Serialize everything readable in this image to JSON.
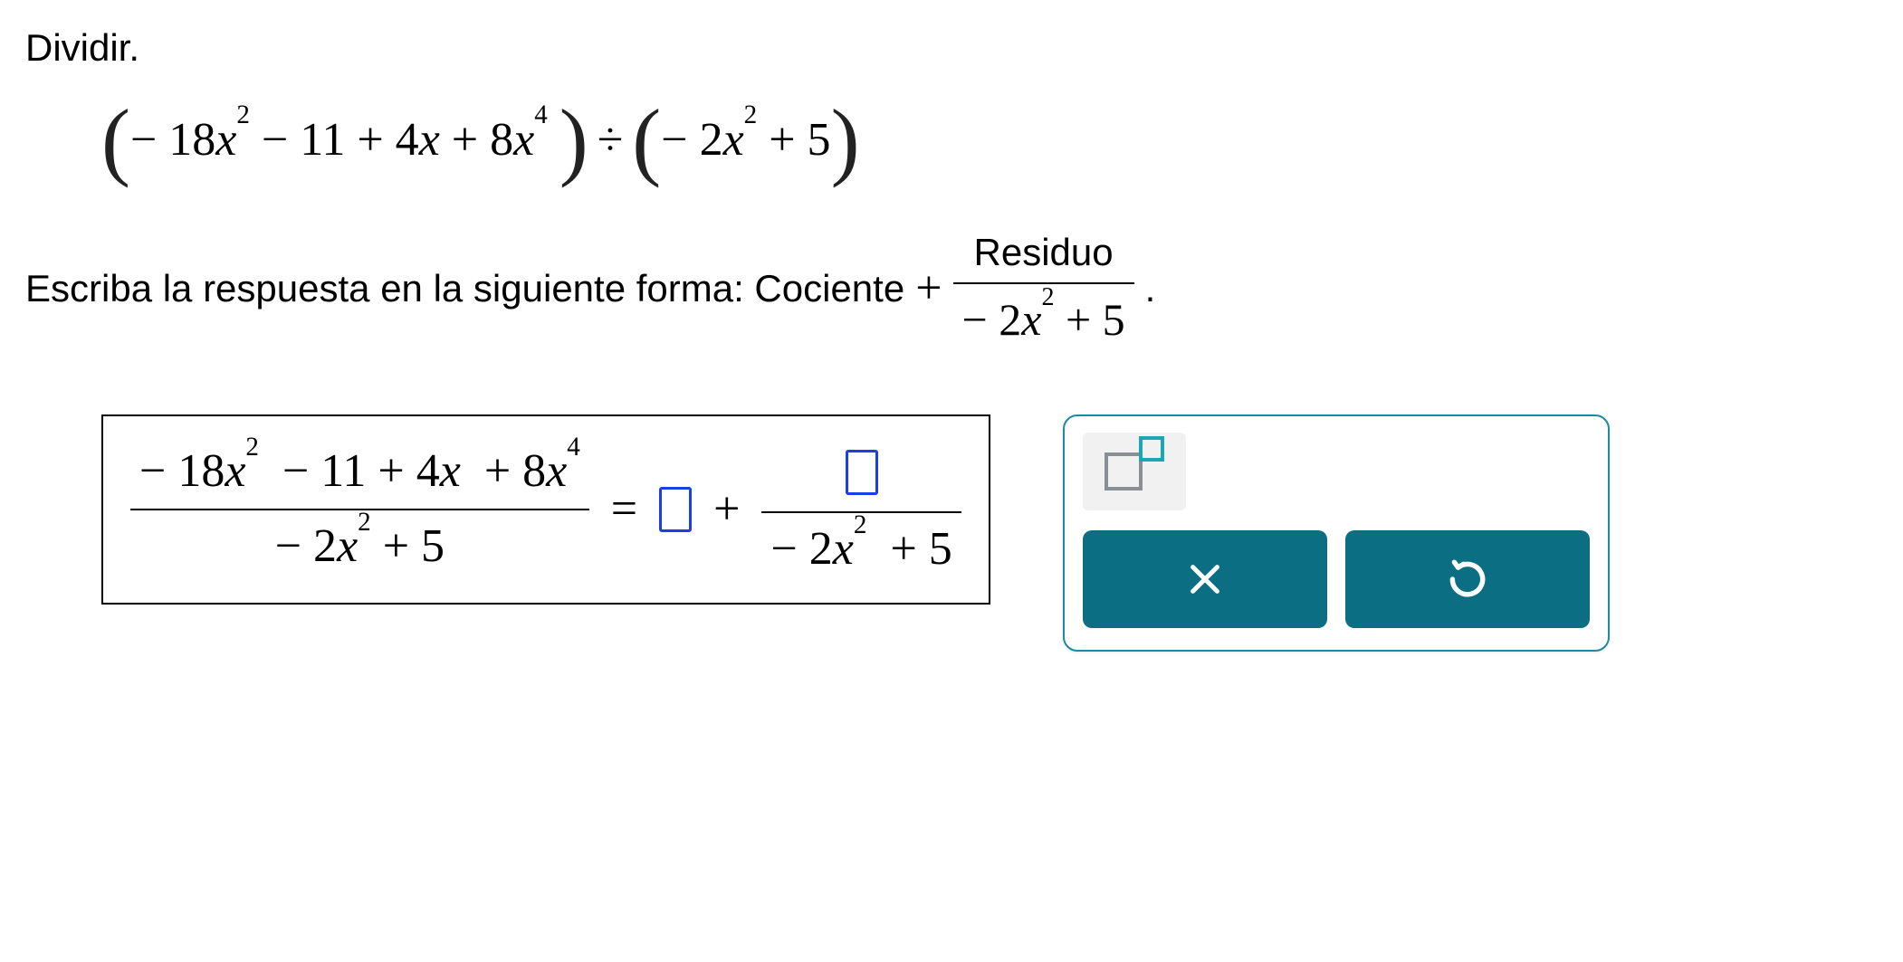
{
  "prompt": "Dividir.",
  "expression": {
    "dividend": "− 18x² − 11 + 4x + 8x⁴",
    "divisor": "− 2x² + 5",
    "dividend_terms": {
      "a": "− 18",
      "b": "− 11 + 4",
      "c": "+ 8"
    },
    "divisor_terms": {
      "a": "− 2",
      "b": "+ 5"
    },
    "op": "÷"
  },
  "form": {
    "text1": "Escriba la respuesta en la siguiente forma: Cociente",
    "plus": "+",
    "frac_top": "Residuo",
    "frac_bot_a": "− 2",
    "frac_bot_b": "+ 5",
    "period": "."
  },
  "answer": {
    "lhs_num_a": "− 18",
    "lhs_num_b": "− 11 + 4",
    "lhs_num_c": "+ 8",
    "lhs_den_a": "− 2",
    "lhs_den_b": "+ 5",
    "eq": "=",
    "quotient_value": "",
    "plus": "+",
    "remainder_value": "",
    "rden_a": "− 2",
    "rden_b": " + 5"
  },
  "panel": {
    "tool_name": "exponent",
    "clear": "clear",
    "undo": "undo"
  },
  "icons": {
    "exponent": "exponent-icon",
    "clear": "close-icon",
    "undo": "undo-icon"
  },
  "colors": {
    "accent": "#1a3fe6",
    "teal": "#0b6e82",
    "teal_border": "#1d8aa0",
    "icon_teal": "#1aa6b5",
    "icon_gray": "#8a8f96"
  }
}
